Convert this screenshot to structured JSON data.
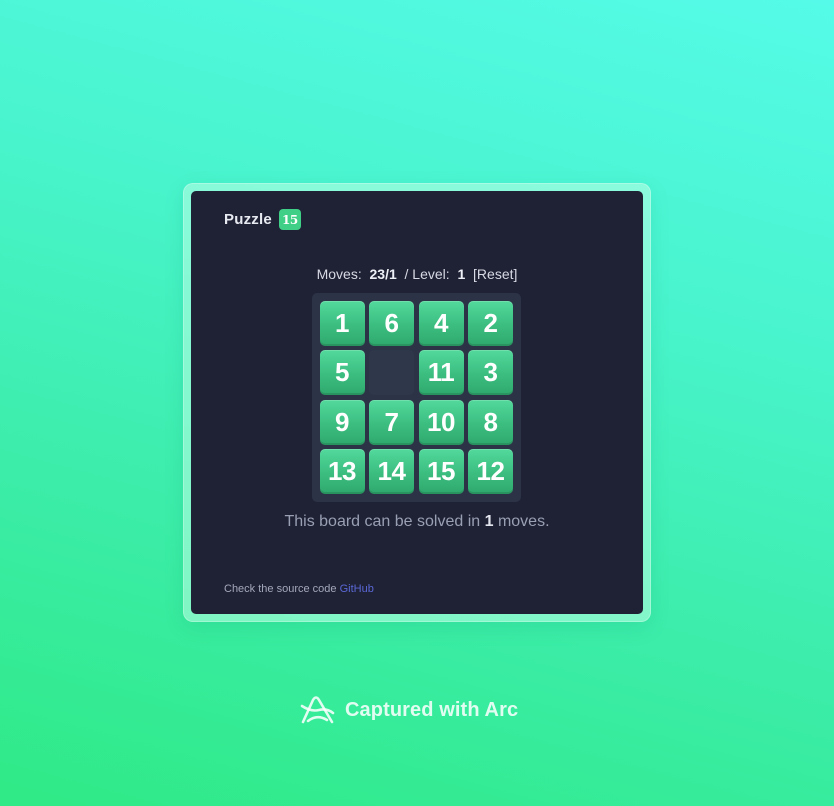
{
  "app": {
    "title": "Puzzle",
    "logo_text": "15"
  },
  "status": {
    "moves_label": "Moves:",
    "moves_value": "23/1",
    "level_label": "/ Level:",
    "level_value": "1",
    "reset_label": "[Reset]"
  },
  "board": {
    "rows": 4,
    "cols": 4,
    "tiles": [
      [
        "1",
        "6",
        "4",
        "2"
      ],
      [
        "5",
        "",
        "11",
        "3"
      ],
      [
        "9",
        "7",
        "10",
        "8"
      ],
      [
        "13",
        "14",
        "15",
        "12"
      ]
    ]
  },
  "solve": {
    "prefix": "This board can be solved in",
    "count": "1",
    "suffix": "moves."
  },
  "footer": {
    "text": "Check the source code",
    "link_label": "GitHub"
  },
  "watermark": {
    "text": "Captured with Arc"
  },
  "colors": {
    "tile": "#3fcf86",
    "panel": "#1f2134",
    "board": "#2c3346",
    "link": "#5a68d6"
  },
  "icons": {
    "logo": "number-badge-icon",
    "watermark": "arc-logo-icon"
  }
}
